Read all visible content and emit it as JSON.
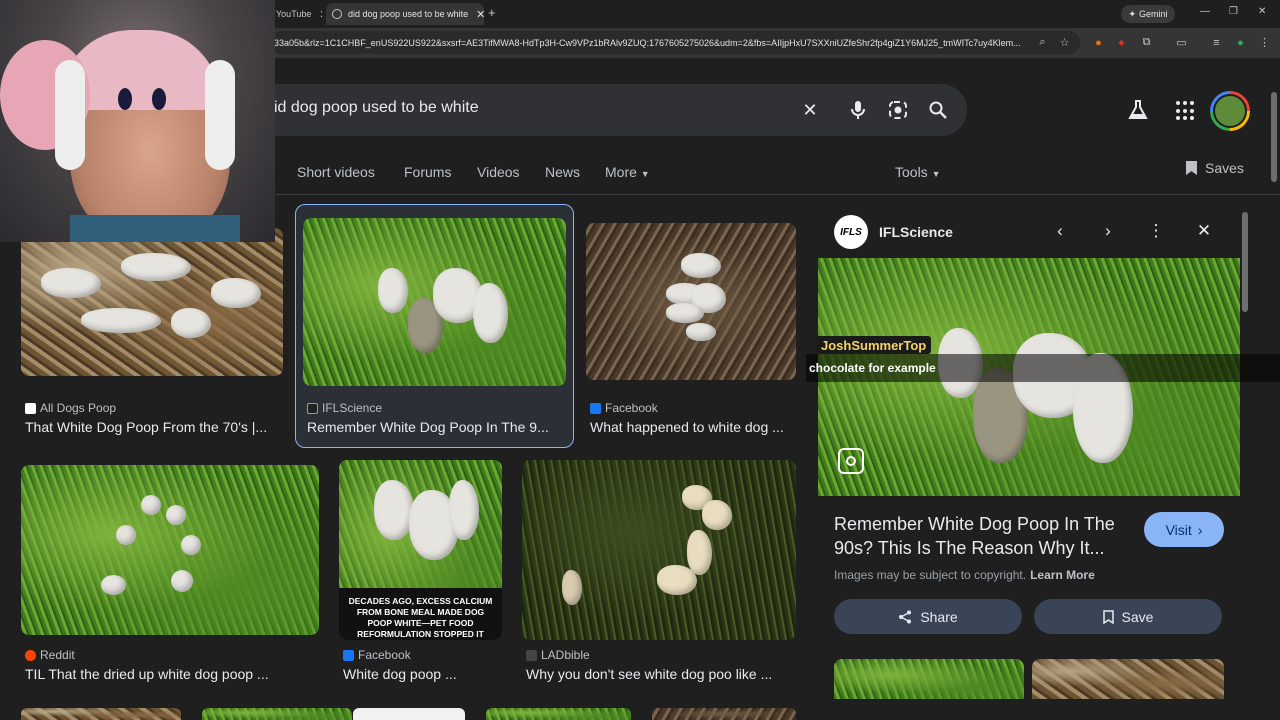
{
  "browser": {
    "tabs": [
      {
        "title": "YouTube",
        "active": false
      },
      {
        "title": "did dog poop used to be white",
        "active": true
      }
    ],
    "gemini_label": "Gemini",
    "url": "33a05b&rlz=1C1CHBF_enUS922US922&sxsrf=AE3TifMWA8-HdTp3H-Cw9VPz1bRAlv9ZUQ:1767605275026&udm=2&fbs=AIIjpHxU7SXXniUZfeShr2fp4giZ1Y6MJ25_tmWITc7uy4Klem..."
  },
  "search": {
    "query": "id dog poop used to be white"
  },
  "nav": {
    "tabs": [
      "Short videos",
      "Forums",
      "Videos",
      "News",
      "More"
    ],
    "tools": "Tools",
    "saves": "Saves"
  },
  "results": [
    {
      "source": "All Dogs Poop",
      "title": "That White Dog Poop From the 70's |..."
    },
    {
      "source": "IFLScience",
      "title": "Remember White Dog Poop In The 9..."
    },
    {
      "source": "Facebook",
      "title": "What happened to white dog ..."
    },
    {
      "source": "Reddit",
      "title": "TIL That the dried up white dog poop ..."
    },
    {
      "source": "Facebook",
      "title": "White dog poop ...",
      "overlay": "DECADES AGO, EXCESS CALCIUM FROM BONE MEAL MADE DOG POOP WHITE—PET FOOD REFORMULATION STOPPED IT"
    },
    {
      "source": "LADbible",
      "title": "Why you don't see white dog poo like ..."
    }
  ],
  "panel": {
    "logo": "IFLS",
    "source": "IFLScience",
    "title": "Remember White Dog Poop In The 90s? This Is The Reason Why It...",
    "visit": "Visit",
    "copyright": "Images may be subject to copyright.",
    "learn_more": "Learn More",
    "share": "Share",
    "save": "Save"
  },
  "overlay": {
    "chat_user": "JoshSummerTop",
    "chat_message": "chocolate for example"
  },
  "colors": {
    "accent": "#8ab4f8",
    "background": "#1f1f1f"
  }
}
